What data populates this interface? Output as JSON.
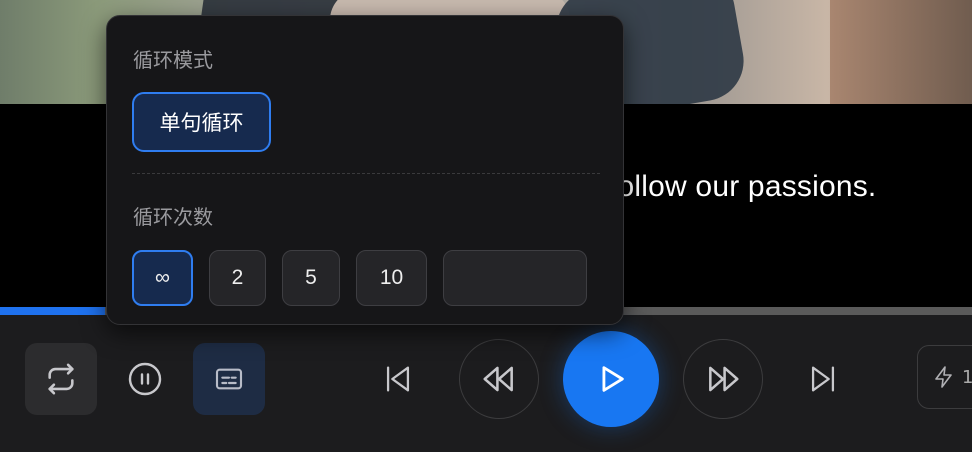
{
  "subtitle": {
    "text": "follow our passions."
  },
  "progress": {
    "fraction": 0.108
  },
  "popup": {
    "loop_mode_title": "循环模式",
    "loop_mode_option": "单句循环",
    "loop_count_title": "循环次数",
    "counts": [
      "∞",
      "2",
      "5",
      "10"
    ],
    "custom_value": ""
  },
  "controls": {
    "icons": [
      "repeat-icon",
      "pause-icon",
      "subtitles-icon",
      "skip-back-icon",
      "rewind-icon",
      "play-icon",
      "fast-forward-icon",
      "skip-forward-icon",
      "speed-icon"
    ],
    "speed_label": "1"
  },
  "colors": {
    "accent": "#1877f2",
    "panel": "#161618",
    "bar": "#1c1c1e"
  }
}
